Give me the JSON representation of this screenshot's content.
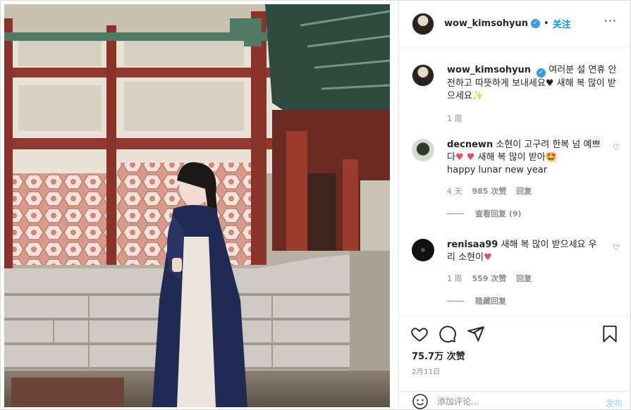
{
  "post": {
    "author": "wow_kimsohyun",
    "follow_label": "关注",
    "dot": "•",
    "verified_mark": "✓",
    "more_label": "···",
    "caption_text": "여러분 설 연휴 안전하고 따뜻하게 보내세요♥ 새해 복 많이 받으세요✨",
    "caption_time": "1 周"
  },
  "comments": [
    {
      "username": "decnewn",
      "text_before": "소현이 고구려 한복 넘 예쁘다",
      "hearts": "♥ ♥",
      "text_after": " 새해 복 많이 받아🤩",
      "line2": "happy lunar new year",
      "time": "4 天",
      "likes": "985 次赞",
      "reply": "回复",
      "view_replies": "查看回复 (9)"
    },
    {
      "username": "renisaa99",
      "text_before": "새해 복 많이 받으세요 우리 소현이",
      "hearts": "♥",
      "time": "1 周",
      "likes": "559 次赞",
      "reply": "回复",
      "hide_replies": "隐藏回复"
    }
  ],
  "actions": {
    "likes_count": "75.7万 次赞",
    "date": "2月11日",
    "comment_placeholder": "添加评论...",
    "post_label": "发布"
  },
  "icons": [
    "heart-icon",
    "comment-icon",
    "share-icon",
    "bookmark-icon",
    "smiley-icon",
    "verified-icon",
    "more-icon"
  ],
  "colors": {
    "accent": "#0095f6",
    "verified": "#3897f0",
    "heart": "#ed4956",
    "muted": "#8e8e8e"
  }
}
